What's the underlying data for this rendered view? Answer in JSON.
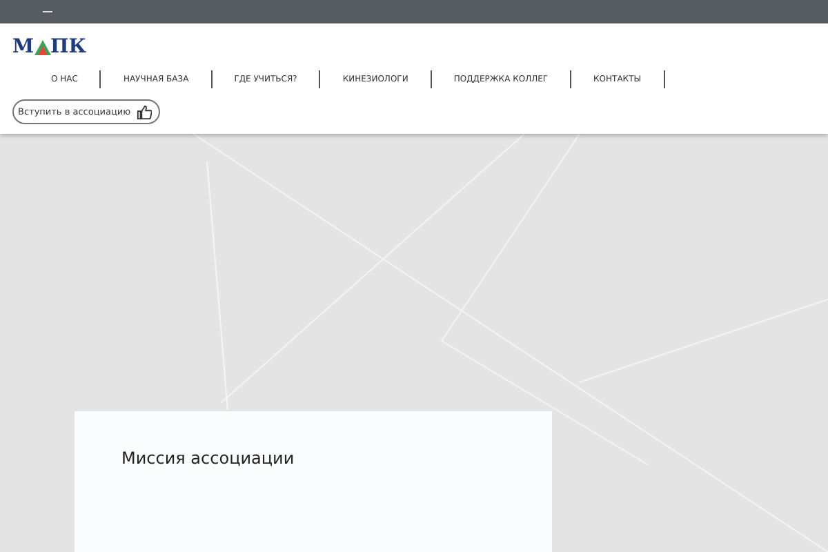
{
  "logo": {
    "left": "М",
    "right": "ПК"
  },
  "nav": [
    {
      "label": "О НАС"
    },
    {
      "label": "НАУЧНАЯ БАЗА"
    },
    {
      "label": "ГДЕ УЧИТЬСЯ?"
    },
    {
      "label": "КИНЕЗИОЛОГИ"
    },
    {
      "label": "ПОДДЕРЖКА КОЛЛЕГ"
    },
    {
      "label": "КОНТАКТЫ"
    }
  ],
  "join_button": {
    "label": "Вступить в ассоциацию"
  },
  "card": {
    "title": "Миссия ассоциации"
  }
}
